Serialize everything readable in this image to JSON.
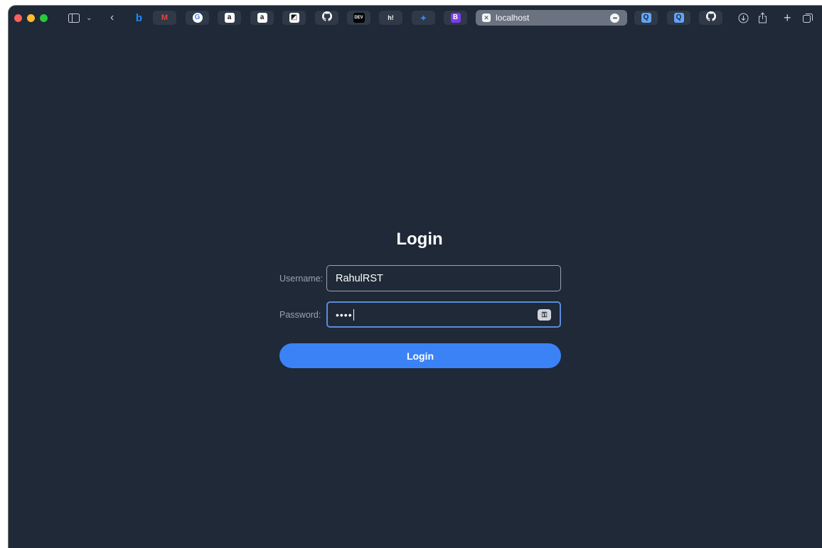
{
  "browser": {
    "url": "localhost",
    "site_icon": "close-box-icon",
    "favorites": [
      {
        "name": "bing-favorite",
        "glyph": "b",
        "color": "#1a8cff",
        "bg": "transparent"
      },
      {
        "name": "gmail-favorite",
        "glyph": "M",
        "color": "#ea4335",
        "bg": "transparent"
      },
      {
        "name": "google-favorite",
        "glyph": "G",
        "color": "#4285f4",
        "bg": "#ffffff"
      },
      {
        "name": "amazon-favorite-1",
        "glyph": "a",
        "color": "#111111",
        "bg": "#ffffff"
      },
      {
        "name": "amazon-favorite-2",
        "glyph": "a",
        "color": "#111111",
        "bg": "#ffffff"
      },
      {
        "name": "bookmark-favorite",
        "glyph": "◩",
        "color": "#111111",
        "bg": "#ffffff"
      },
      {
        "name": "github-favorite",
        "glyph": "●",
        "color": "#ffffff",
        "bg": "transparent"
      },
      {
        "name": "dev-favorite",
        "glyph": "DEV",
        "color": "#ffffff",
        "bg": "#000000"
      },
      {
        "name": "hashnode-favorite",
        "glyph": "h!",
        "color": "#ffffff",
        "bg": "transparent"
      },
      {
        "name": "sparkle-favorite",
        "glyph": "✦",
        "color": "#3b82f6",
        "bg": "transparent"
      },
      {
        "name": "bootstrap-favorite",
        "glyph": "B",
        "color": "#ffffff",
        "bg": "#7c3aed"
      }
    ],
    "right_favorites": [
      {
        "name": "search-favorite-1",
        "glyph": "Q",
        "color": "#1f2937",
        "bg": "#60a5fa"
      },
      {
        "name": "search-favorite-2",
        "glyph": "Q",
        "color": "#1f2937",
        "bg": "#60a5fa"
      },
      {
        "name": "github-favorite-2",
        "glyph": "●",
        "color": "#ffffff",
        "bg": "transparent"
      }
    ]
  },
  "login": {
    "title": "Login",
    "username_label": "Username:",
    "username_value": "RahulRST",
    "password_label": "Password:",
    "password_value": "••••",
    "button_label": "Login"
  }
}
